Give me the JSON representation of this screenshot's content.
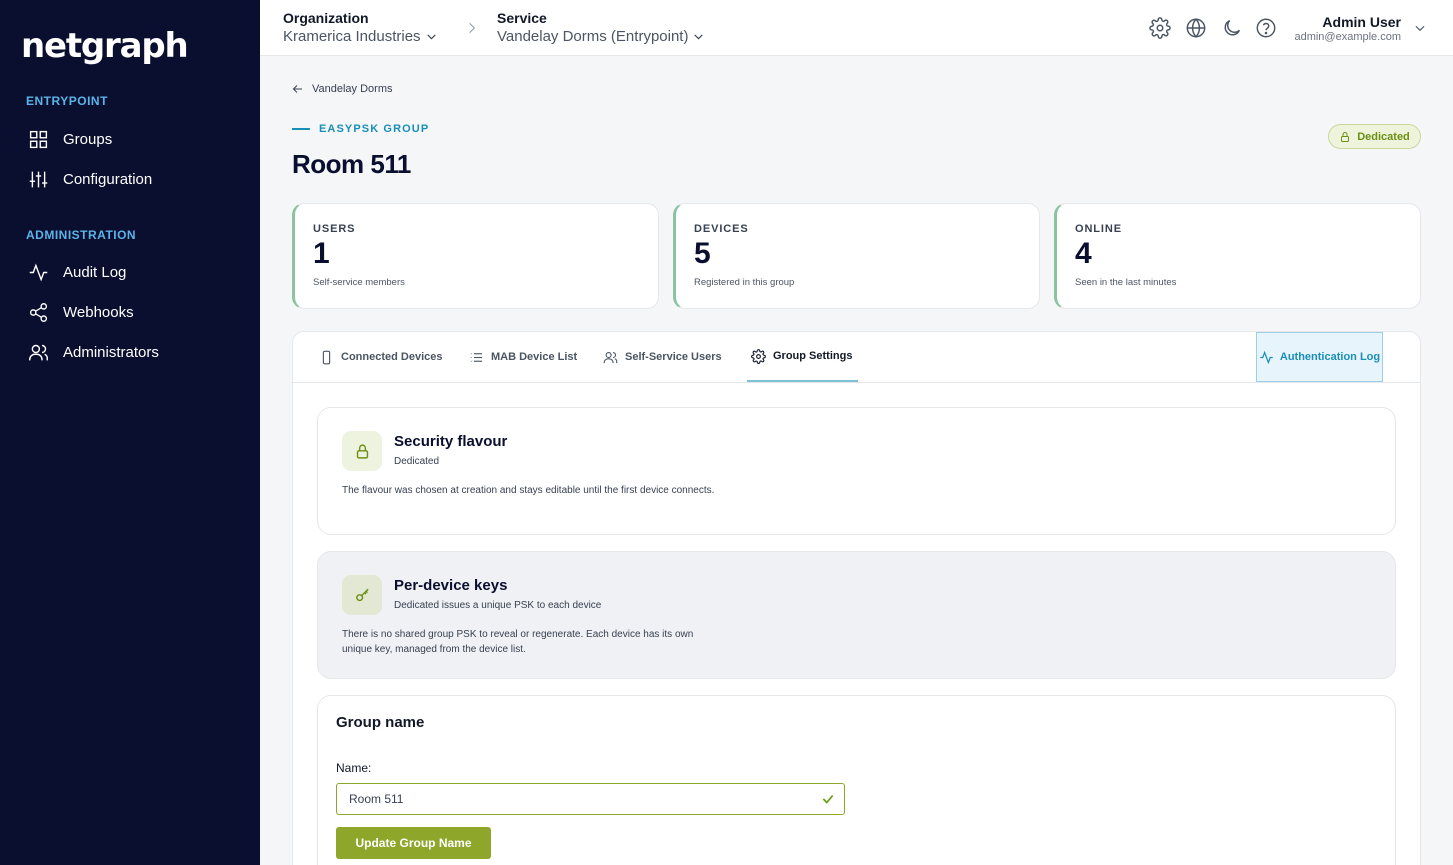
{
  "sidebar": {
    "logo": "netgraph",
    "sections": [
      {
        "label": "ENTRYPOINT",
        "items": [
          {
            "label": "Groups",
            "icon": "grid-icon"
          },
          {
            "label": "Configuration",
            "icon": "sliders-icon"
          }
        ]
      },
      {
        "label": "ADMINISTRATION",
        "items": [
          {
            "label": "Audit Log",
            "icon": "activity-icon"
          },
          {
            "label": "Webhooks",
            "icon": "share-icon"
          },
          {
            "label": "Administrators",
            "icon": "users-icon"
          }
        ]
      }
    ]
  },
  "topbar": {
    "org_label": "Organization",
    "org_value": "Kramerica Industries",
    "service_label": "Service",
    "service_value": "Vandelay Dorms (Entrypoint)",
    "user_name": "Admin User",
    "user_email": "admin@example.com"
  },
  "page": {
    "back_label": "Vandelay Dorms",
    "eyebrow": "EASYPSK GROUP",
    "title": "Room 511",
    "badge": "Dedicated"
  },
  "stats": [
    {
      "label": "USERS",
      "value": "1",
      "sub": "Self-service members"
    },
    {
      "label": "DEVICES",
      "value": "5",
      "sub": "Registered in this group"
    },
    {
      "label": "ONLINE",
      "value": "4",
      "sub": "Seen in the last minutes"
    }
  ],
  "tabs": {
    "items": [
      "Connected Devices",
      "MAB Device List",
      "Self-Service Users",
      "Group Settings"
    ],
    "active": "Group Settings",
    "auth_log": "Authentication Log"
  },
  "settings": {
    "security": {
      "title": "Security flavour",
      "sub": "Dedicated",
      "desc": "The flavour was chosen at creation and stays editable until the first device connects."
    },
    "keys": {
      "title": "Per-device keys",
      "sub": "Dedicated issues a unique PSK to each device",
      "desc": "There is no shared group PSK to reveal or regenerate. Each device has its own unique key, managed from the device list."
    },
    "group_name": {
      "title": "Group name",
      "field_label": "Name:",
      "value": "Room 511",
      "button": "Update Group Name"
    }
  },
  "colors": {
    "sidebar_bg": "#0b0f2f",
    "accent_blue": "#1a8fb6",
    "accent_green": "#8ea62a"
  }
}
